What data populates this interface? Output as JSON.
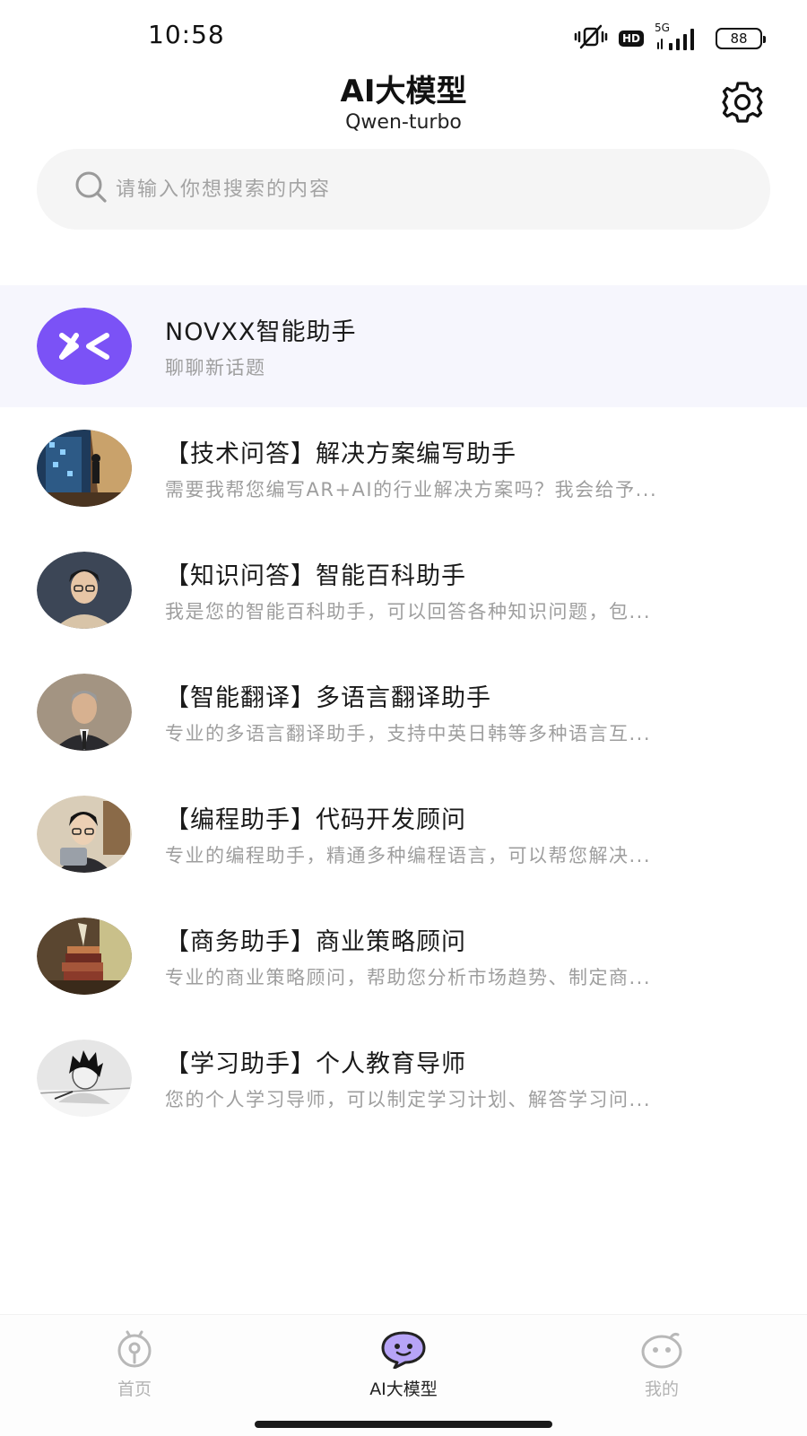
{
  "status_bar": {
    "time": "10:58",
    "network": "5G",
    "hd_badge": "HD",
    "battery": "88"
  },
  "header": {
    "title": "AI大模型",
    "subtitle": "Qwen-turbo",
    "settings_icon": "gear-icon"
  },
  "search": {
    "placeholder": "请输入你想搜索的内容",
    "icon": "search-icon"
  },
  "featured": {
    "title": "NOVXX智能助手",
    "desc": "聊聊新话题",
    "logo_text": "XK",
    "accent": "#7b52f6"
  },
  "assistants": [
    {
      "title": "【技术问答】解决方案编写助手",
      "desc": "需要我帮您编写AR+AI的行业解决方案吗？我会给予..."
    },
    {
      "title": "【知识问答】智能百科助手",
      "desc": "我是您的智能百科助手，可以回答各种知识问题，包..."
    },
    {
      "title": "【智能翻译】多语言翻译助手",
      "desc": "专业的多语言翻译助手，支持中英日韩等多种语言互..."
    },
    {
      "title": "【编程助手】代码开发顾问",
      "desc": "专业的编程助手，精通多种编程语言，可以帮您解决..."
    },
    {
      "title": "【商务助手】商业策略顾问",
      "desc": "专业的商业策略顾问，帮助您分析市场趋势、制定商..."
    },
    {
      "title": "【学习助手】个人教育导师",
      "desc": "您的个人学习导师，可以制定学习计划、解答学习问..."
    }
  ],
  "nav": {
    "home": "首页",
    "ai": "AI大模型",
    "me": "我的",
    "active": "ai",
    "active_color": "#222222",
    "inactive_color": "#b3b3b3"
  }
}
